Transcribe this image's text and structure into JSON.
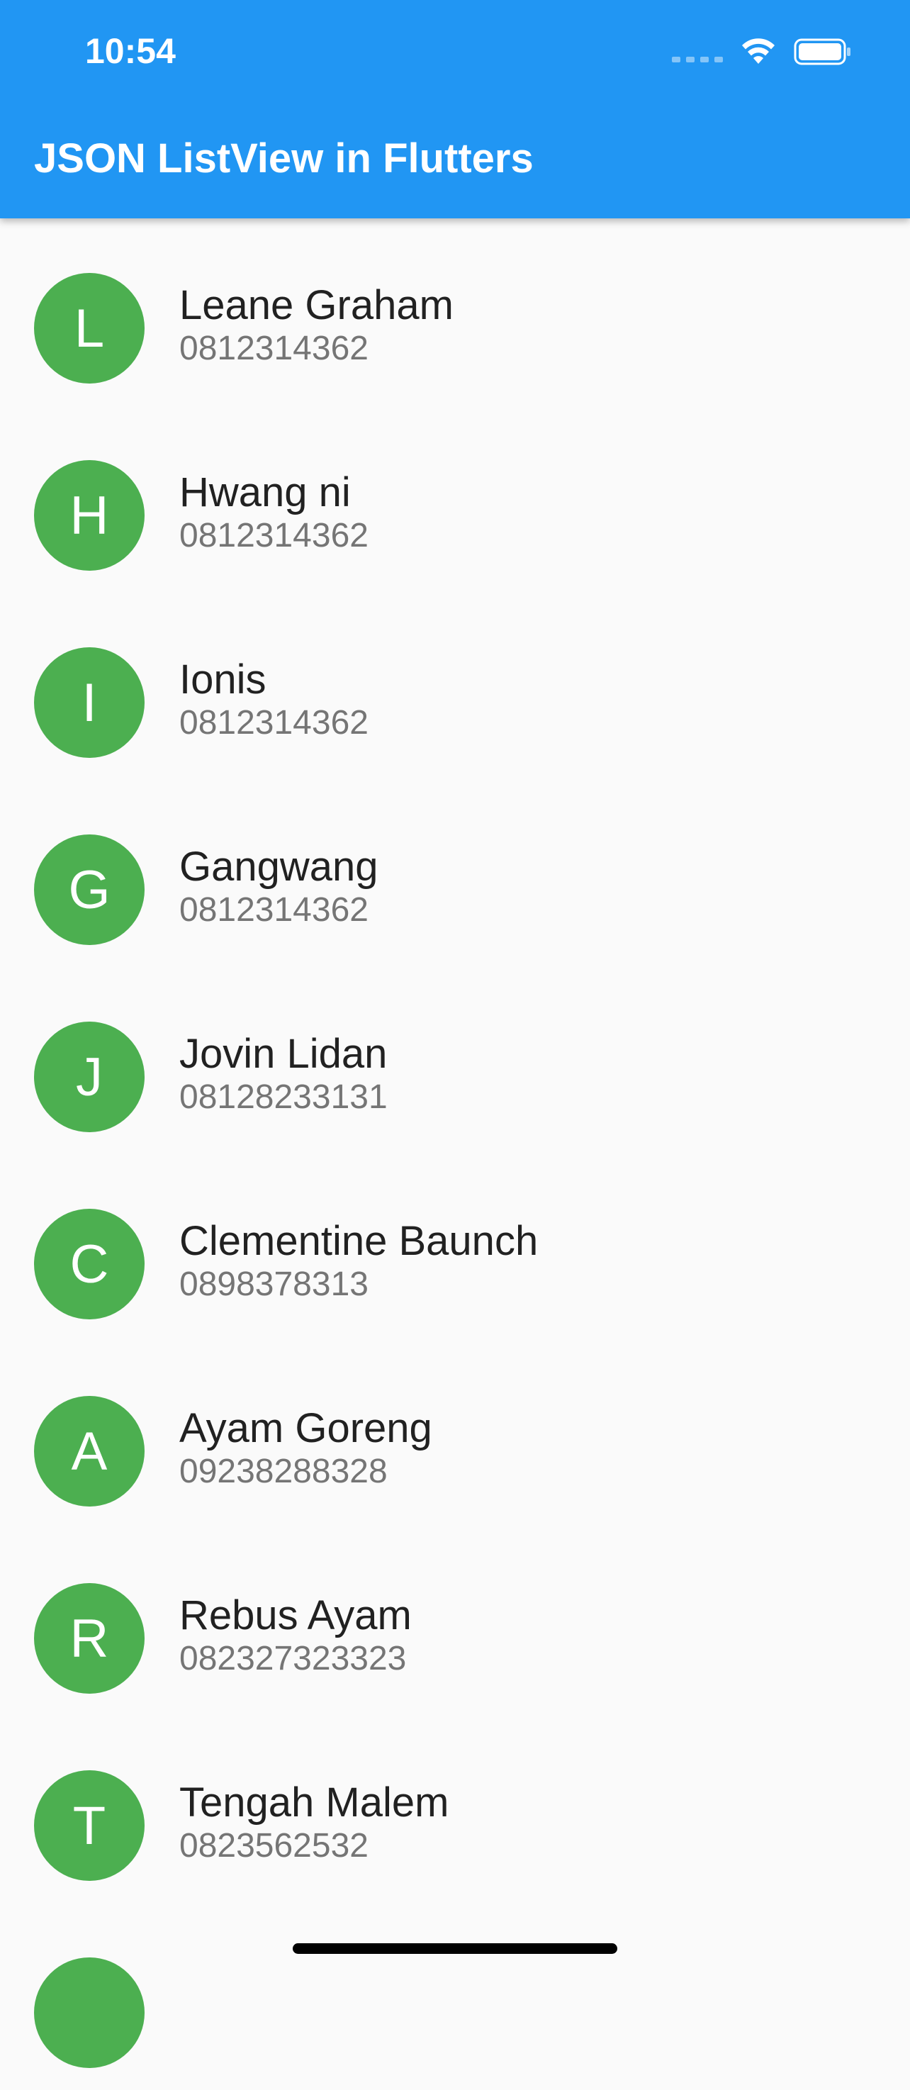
{
  "status_bar": {
    "time": "10:54",
    "icons": [
      "signal-icon",
      "wifi-icon",
      "battery-icon"
    ]
  },
  "app_bar": {
    "title": "JSON ListView in Flutters",
    "color": "#2196f3"
  },
  "colors": {
    "avatar": "#4caf50",
    "background": "#fafafa"
  },
  "contacts": [
    {
      "initial": "L",
      "name": "Leane Graham",
      "phone": "0812314362"
    },
    {
      "initial": "H",
      "name": "Hwang ni",
      "phone": "0812314362"
    },
    {
      "initial": "I",
      "name": "Ionis",
      "phone": "0812314362"
    },
    {
      "initial": "G",
      "name": "Gangwang",
      "phone": "0812314362"
    },
    {
      "initial": "J",
      "name": "Jovin Lidan",
      "phone": "08128233131"
    },
    {
      "initial": "C",
      "name": "Clementine Baunch",
      "phone": "0898378313"
    },
    {
      "initial": "A",
      "name": "Ayam Goreng",
      "phone": "09238288328"
    },
    {
      "initial": "R",
      "name": "Rebus Ayam",
      "phone": "082327323323"
    },
    {
      "initial": "T",
      "name": "Tengah Malem",
      "phone": "0823562532"
    },
    {
      "initial": "",
      "name": "",
      "phone": ""
    }
  ]
}
